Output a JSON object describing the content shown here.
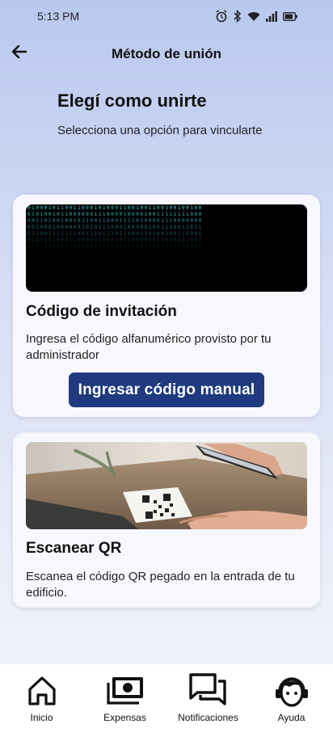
{
  "status_bar": {
    "time": "5:13 PM"
  },
  "header": {
    "title": "Método de unión"
  },
  "page": {
    "heading": "Elegí como unirte",
    "subheading": "Selecciona una opción para vincularte"
  },
  "cards": {
    "invite": {
      "title": "Código de invitación",
      "description": "Ingresa el código alfanumérico provisto por tu administrador",
      "button_label": "Ingresar código manual"
    },
    "qr": {
      "title": "Escanear QR",
      "description": "Escanea el código QR pegado en la entrada de tu edificio."
    }
  },
  "bottom_nav": {
    "items": [
      {
        "label": "Inicio",
        "icon": "home-icon"
      },
      {
        "label": "Expensas",
        "icon": "money-icon"
      },
      {
        "label": "Notificaciones",
        "icon": "chat-icon"
      },
      {
        "label": "Ayuda",
        "icon": "support-agent-icon"
      }
    ]
  },
  "colors": {
    "accent": "#1f3a7e",
    "binary_text": "#3fd0d8"
  }
}
